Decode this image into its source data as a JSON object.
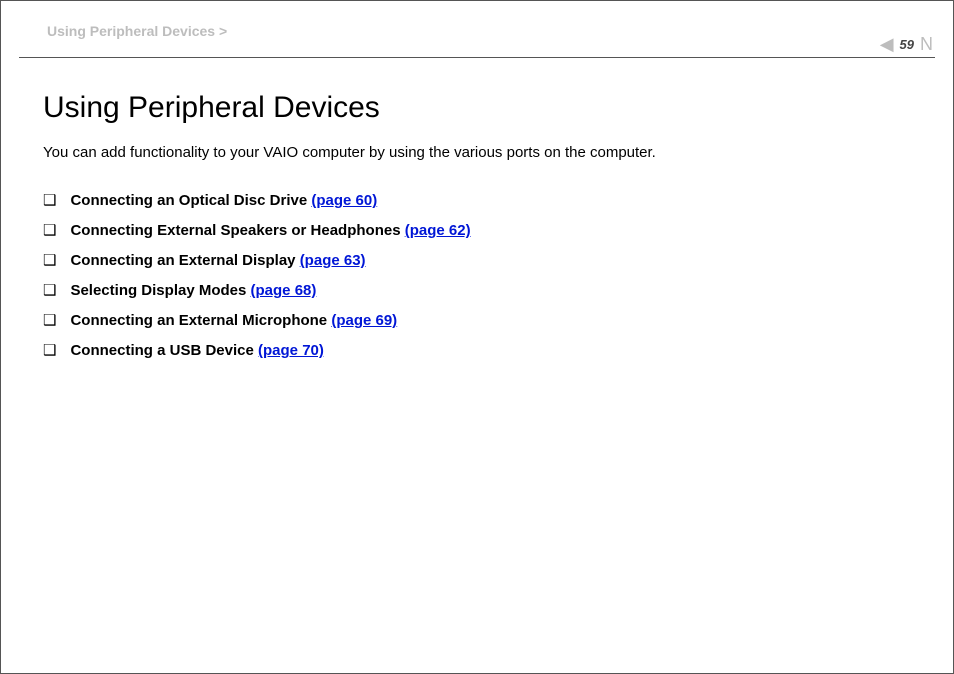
{
  "breadcrumb": {
    "text": "Using Peripheral Devices",
    "sep": ">"
  },
  "pager": {
    "prev_glyph": "◀",
    "page_number": "59",
    "next_glyph": "N"
  },
  "title": "Using Peripheral Devices",
  "intro": "You can add functionality to your VAIO computer by using the various ports on the computer.",
  "bullet_glyph": "❑",
  "toc": [
    {
      "label": "Connecting an Optical Disc Drive",
      "pageref": "(page 60)"
    },
    {
      "label": "Connecting External Speakers or Headphones",
      "pageref": "(page 62)"
    },
    {
      "label": "Connecting an External Display",
      "pageref": "(page 63)"
    },
    {
      "label": "Selecting Display Modes",
      "pageref": "(page 68)"
    },
    {
      "label": "Connecting an External Microphone",
      "pageref": "(page 69)"
    },
    {
      "label": "Connecting a USB Device",
      "pageref": "(page 70)"
    }
  ]
}
